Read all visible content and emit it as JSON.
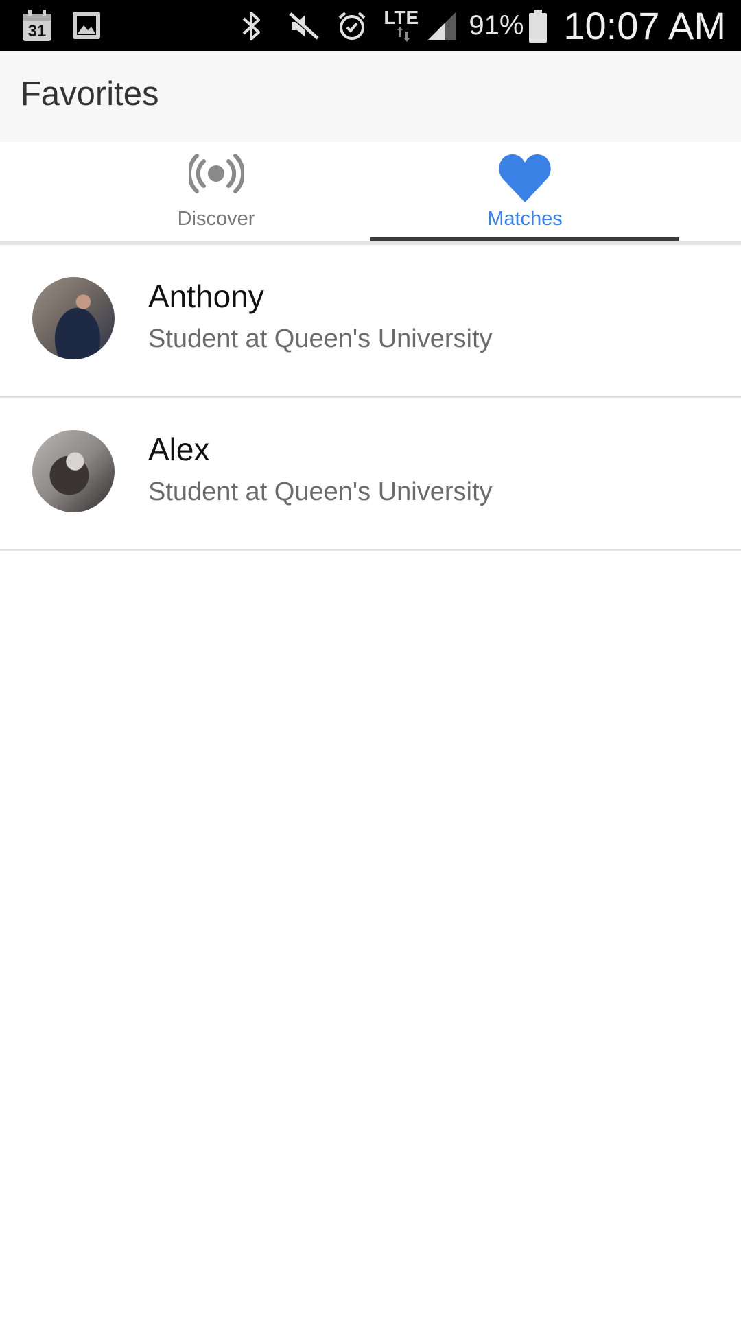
{
  "status_bar": {
    "calendar_day": "31",
    "battery_percent": "91%",
    "network": "LTE",
    "time": "10:07 AM",
    "icons": [
      "calendar-icon",
      "gallery-icon",
      "bluetooth-icon",
      "mute-icon",
      "alarm-icon",
      "lte-icon",
      "signal-icon",
      "battery-icon"
    ]
  },
  "app_bar": {
    "title": "Favorites"
  },
  "tabs": [
    {
      "label": "Discover",
      "icon": "broadcast-icon",
      "active": false
    },
    {
      "label": "Matches",
      "icon": "heart-icon",
      "active": true
    }
  ],
  "colors": {
    "accent": "#3b82e6",
    "indicator": "#3a3a3a",
    "app_bar_bg": "#f7f7f7",
    "status_bar_bg": "#000000"
  },
  "matches": [
    {
      "name": "Anthony",
      "subtitle": "Student at Queen's University"
    },
    {
      "name": "Alex",
      "subtitle": "Student at Queen's University"
    }
  ]
}
